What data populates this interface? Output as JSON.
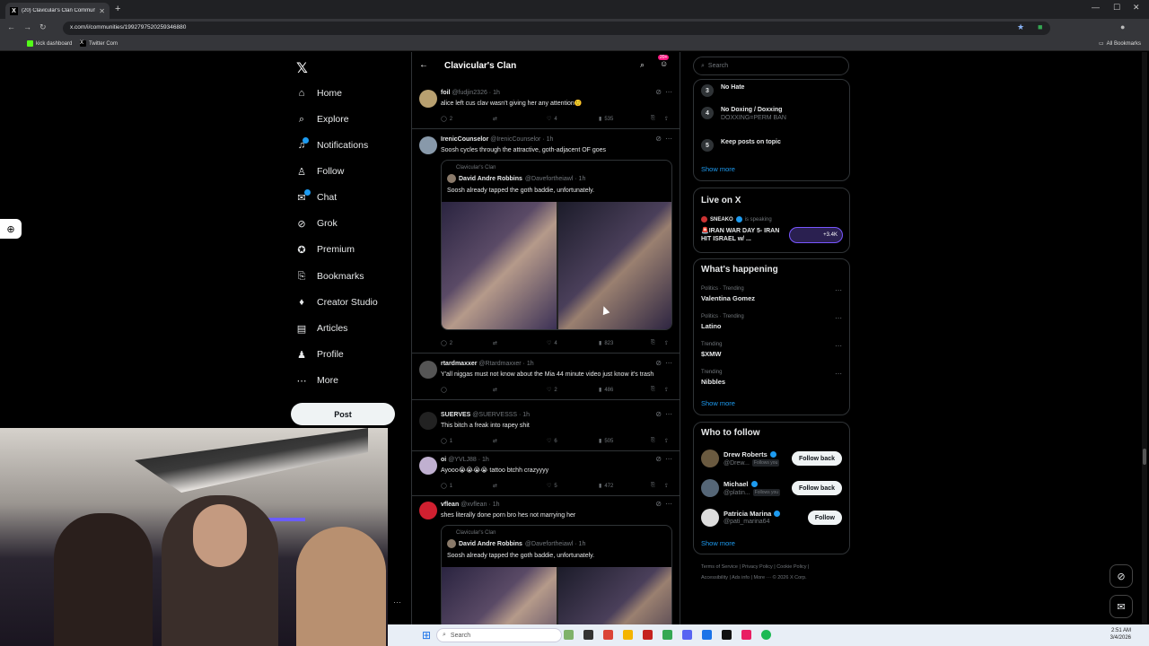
{
  "browser": {
    "tab_title": "(20) Clavicular's Clan Communi",
    "url": "x.com/i/communities/1992797520259346880",
    "bookmarks": [
      "kick dashboard",
      "Twitter Com"
    ],
    "all_bookmarks": "All Bookmarks"
  },
  "nav": {
    "items": [
      {
        "label": "Home",
        "icon": "home-icon"
      },
      {
        "label": "Explore",
        "icon": "search-icon"
      },
      {
        "label": "Notifications",
        "icon": "bell-icon"
      },
      {
        "label": "Follow",
        "icon": "person-add-icon"
      },
      {
        "label": "Chat",
        "icon": "chat-icon"
      },
      {
        "label": "Grok",
        "icon": "grok-icon"
      },
      {
        "label": "Premium",
        "icon": "premium-icon"
      },
      {
        "label": "Bookmarks",
        "icon": "bookmark-icon"
      },
      {
        "label": "Creator Studio",
        "icon": "creator-icon"
      },
      {
        "label": "Articles",
        "icon": "articles-icon"
      },
      {
        "label": "Profile",
        "icon": "profile-icon"
      },
      {
        "label": "More",
        "icon": "more-icon"
      }
    ],
    "post_label": "Post"
  },
  "feed": {
    "title": "Clavicular's Clan",
    "badge": "20+",
    "tweets": [
      {
        "name": "foil",
        "handle": "@fudjin2326 · 1h",
        "text": "alice left cus clav wasn't giving her any attention🙂",
        "replies": "2",
        "likes": "4",
        "views": "535"
      },
      {
        "name": "IrenicCounselor",
        "handle": "@IrenicCounselor · 1h",
        "text": "Soosh cycles through the attractive, goth-adjacent OF goes",
        "quote": {
          "community": "Clavicular's Clan",
          "name": "David Andre Robbins",
          "handle": "@Davefortheiawl · 1h",
          "text": "Soosh already tapped the goth baddie, unfortunately."
        },
        "replies": "2",
        "likes": "4",
        "views": "823"
      },
      {
        "name": "rtardmaxxer",
        "handle": "@Rtardmaxxer · 1h",
        "text": "Y'all niggas must not know about the Mia 44 minute video just know it's trash",
        "replies": "",
        "likes": "2",
        "views": "486"
      },
      {
        "name": "SUERVES",
        "handle": "@SUERVESSS · 1h",
        "text": "This bitch a freak into rapey shit",
        "replies": "1",
        "likes": "6",
        "views": "505"
      },
      {
        "name": "oi",
        "handle": "@YVLJ88 · 1h",
        "text": "Ayooo😭😭😭😭 tattoo btchh crazyyyy",
        "replies": "1",
        "likes": "5",
        "views": "472"
      },
      {
        "name": "vflean",
        "handle": "@xvflean · 1h",
        "text": "shes literally done porn bro hes not marrying her",
        "quote": {
          "community": "Clavicular's Clan",
          "name": "David Andre Robbins",
          "handle": "@Davefortheiawl · 1h",
          "text": "Soosh already tapped the goth baddie, unfortunately."
        }
      }
    ]
  },
  "right": {
    "search_placeholder": "Search",
    "rules": [
      {
        "num": "3",
        "title": "No Hate",
        "sub": ""
      },
      {
        "num": "4",
        "title": "No Doxing / Doxxing",
        "sub": "DOXXING=PERM BAN"
      },
      {
        "num": "5",
        "title": "Keep posts on topic",
        "sub": ""
      }
    ],
    "show_more": "Show more",
    "live": {
      "title": "Live on X",
      "host": "SNEAKO",
      "status": "is speaking",
      "headline": "🚨IRAN WAR DAY 5- IRAN HIT ISRAEL w/ ...",
      "count": "+3.4K"
    },
    "happening": {
      "title": "What's happening",
      "trends": [
        {
          "meta": "Politics · Trending",
          "name": "Valentina Gomez"
        },
        {
          "meta": "Politics · Trending",
          "name": "Latino"
        },
        {
          "meta": "Trending",
          "name": "$XMW"
        },
        {
          "meta": "Trending",
          "name": "Nibbles"
        }
      ]
    },
    "wtf": {
      "title": "Who to follow",
      "users": [
        {
          "name": "Drew Roberts",
          "handle": "@Drew...",
          "follows_you": "Follows you",
          "button": "Follow back"
        },
        {
          "name": "Michael",
          "handle": "@platin...",
          "follows_you": "Follows you",
          "button": "Follow back"
        },
        {
          "name": "Patricia Marina",
          "handle": "@pati_marina64",
          "follows_you": "",
          "button": "Follow"
        }
      ]
    },
    "footer": {
      "line1": [
        "Terms of Service",
        "Privacy Policy",
        "Cookie Policy"
      ],
      "line2": [
        "Accessibility",
        "Ads info",
        "More ···",
        "© 2026 X Corp."
      ]
    }
  },
  "taskbar": {
    "search": "Search",
    "time": "2:51 AM",
    "date": "3/4/2026"
  },
  "colors": {
    "accent": "#1d9bf0",
    "bg": "#000000",
    "border": "#2f3336",
    "badge": "#f91880"
  }
}
